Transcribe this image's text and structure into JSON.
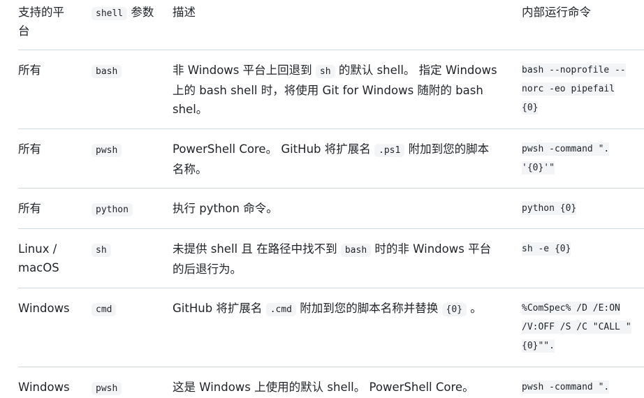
{
  "headers": {
    "platform_line1": "支持的平",
    "platform_line2": "台",
    "param_code": "shell",
    "param_text": "参数",
    "desc": "描述",
    "cmd": "内部运行命令"
  },
  "rows": [
    {
      "platform": "所有",
      "param": "bash",
      "desc_l1_a": "非 Windows 平台上回退到",
      "desc_l1_code": "sh",
      "desc_l1_b": "的默认 shell。 指定 Windows",
      "desc_l2": "上的 bash shell 时，将使用 Git for Windows 随附的 bash",
      "desc_l3": "shel。",
      "cmd_l1": "bash --noprofile --",
      "cmd_l2": "norc -eo pipefail",
      "cmd_l3": "{0}"
    },
    {
      "platform": "所有",
      "param": "pwsh",
      "desc_l1_a": "PowerShell Core。 GitHub 将扩展名",
      "desc_l1_code": ".ps1",
      "desc_l1_b": "附加到您的脚本",
      "desc_l2": "名称。",
      "cmd_l1": "pwsh -command \".",
      "cmd_l2": "'{0}'\""
    },
    {
      "platform": "所有",
      "param": "python",
      "desc_l1": "执行 python 命令。",
      "cmd_l1": "python {0}"
    },
    {
      "platform_l1": "Linux /",
      "platform_l2": "macOS",
      "param": "sh",
      "desc_l1_a": "未提供 shell 且 在路径中找不到",
      "desc_l1_code": "bash",
      "desc_l1_b": "时的非 Windows 平台",
      "desc_l2": "的后退行为。",
      "cmd_l1": "sh -e {0}"
    },
    {
      "platform": "Windows",
      "param": "cmd",
      "desc_a": "GitHub 将扩展名",
      "desc_code1": ".cmd",
      "desc_b": "附加到您的脚本名称并替换",
      "desc_code2": "{0}",
      "desc_c": "。",
      "cmd_l1": "%ComSpec% /D /E:ON",
      "cmd_l2": "/V:OFF /S /C \"CALL \"",
      "cmd_l3": "{0}\"\"."
    },
    {
      "platform": "Windows",
      "param": "pwsh",
      "desc_l1": "这是 Windows 上使用的默认 shell。 PowerShell Core。",
      "cmd_l1": "pwsh -command \"."
    }
  ]
}
